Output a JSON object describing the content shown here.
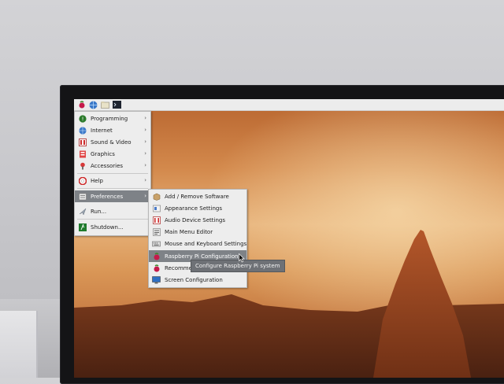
{
  "taskbar": {
    "icons": [
      "raspberry-icon",
      "globe-icon",
      "folder-icon",
      "terminal-icon"
    ]
  },
  "main_menu": {
    "items": [
      {
        "label": "Programming",
        "icon": "programming-icon",
        "submenu": true
      },
      {
        "label": "Internet",
        "icon": "globe-icon",
        "submenu": true
      },
      {
        "label": "Sound & Video",
        "icon": "sound-video-icon",
        "submenu": true
      },
      {
        "label": "Graphics",
        "icon": "graphics-icon",
        "submenu": true
      },
      {
        "label": "Accessories",
        "icon": "accessories-icon",
        "submenu": true
      },
      {
        "label": "Help",
        "icon": "help-icon",
        "submenu": true
      },
      {
        "label": "Preferences",
        "icon": "preferences-icon",
        "submenu": true,
        "selected": true
      },
      {
        "label": "Run...",
        "icon": "run-icon",
        "submenu": false
      },
      {
        "label": "Shutdown...",
        "icon": "shutdown-icon",
        "submenu": false
      }
    ]
  },
  "preferences_menu": {
    "items": [
      {
        "label": "Add / Remove Software",
        "icon": "package-icon"
      },
      {
        "label": "Appearance Settings",
        "icon": "appearance-icon"
      },
      {
        "label": "Audio Device Settings",
        "icon": "audio-icon"
      },
      {
        "label": "Main Menu Editor",
        "icon": "menu-editor-icon"
      },
      {
        "label": "Mouse and Keyboard Settings",
        "icon": "keyboard-icon"
      },
      {
        "label": "Raspberry Pi Configuration",
        "icon": "raspberry-icon",
        "selected": true
      },
      {
        "label": "Recommen",
        "icon": "raspberry-icon"
      },
      {
        "label": "Screen Configuration",
        "icon": "screen-icon"
      }
    ]
  },
  "tooltip": {
    "text": "Configure Raspberry Pi system"
  },
  "colors": {
    "menu_bg": "#ededed",
    "selection": "#7e8287",
    "tooltip_bg": "#6e7176",
    "raspberry": "#c51a4a",
    "sunset": "#d98a48"
  }
}
